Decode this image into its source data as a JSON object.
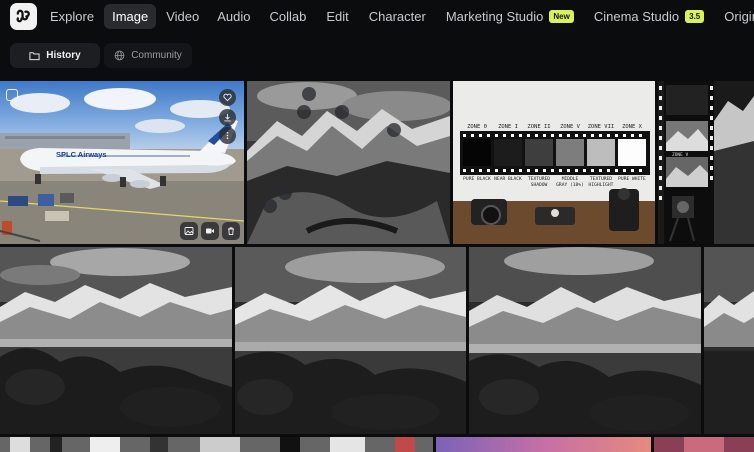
{
  "nav": {
    "items": [
      {
        "label": "Explore",
        "active": false
      },
      {
        "label": "Image",
        "active": true
      },
      {
        "label": "Video",
        "active": false
      },
      {
        "label": "Audio",
        "active": false
      },
      {
        "label": "Collab",
        "active": false
      },
      {
        "label": "Edit",
        "active": false
      },
      {
        "label": "Character",
        "active": false
      },
      {
        "label": "Marketing Studio",
        "active": false,
        "badge": "New"
      },
      {
        "label": "Cinema Studio",
        "active": false,
        "badge": "3.5"
      },
      {
        "label": "Origina",
        "active": false
      }
    ]
  },
  "subtabs": {
    "history": "History",
    "community": "Community"
  },
  "gallery": {
    "airplane_text": "SPLC Airways",
    "film_strip": {
      "zones": [
        "ZONE 0",
        "ZONE I",
        "ZONE II",
        "ZONE V",
        "ZONE VII",
        "ZONE X"
      ],
      "captions": [
        "PURE BLACK",
        "NEAR BLACK",
        "TEXTURED SHADOW",
        "MIDDLE GRAY (18%)",
        "TEXTURED HIGHLIGHT",
        "PURE WHITE"
      ]
    },
    "film_frame_labels": [
      "ZONE V"
    ]
  },
  "colors": {
    "accent_badge": "#d7f35b",
    "background": "#0b0c0e",
    "active_tab": "#2a2b2f"
  },
  "icons": {
    "logo": "app-logo-icon",
    "history": "folder-icon",
    "community": "globe-icon",
    "favorite": "heart-icon",
    "download": "download-icon",
    "more": "more-vertical-icon",
    "to_image": "image-icon",
    "to_video": "video-icon",
    "delete": "trash-icon"
  }
}
